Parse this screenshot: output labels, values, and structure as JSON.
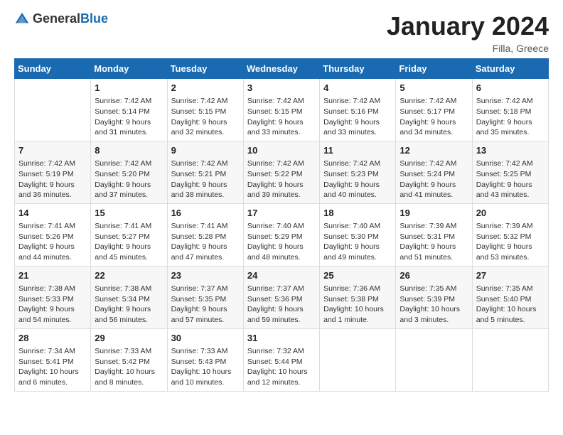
{
  "header": {
    "logo_general": "General",
    "logo_blue": "Blue",
    "title": "January 2024",
    "subtitle": "Filla, Greece"
  },
  "columns": [
    "Sunday",
    "Monday",
    "Tuesday",
    "Wednesday",
    "Thursday",
    "Friday",
    "Saturday"
  ],
  "weeks": [
    [
      {
        "day": "",
        "sunrise": "",
        "sunset": "",
        "daylight": ""
      },
      {
        "day": "1",
        "sunrise": "Sunrise: 7:42 AM",
        "sunset": "Sunset: 5:14 PM",
        "daylight": "Daylight: 9 hours and 31 minutes."
      },
      {
        "day": "2",
        "sunrise": "Sunrise: 7:42 AM",
        "sunset": "Sunset: 5:15 PM",
        "daylight": "Daylight: 9 hours and 32 minutes."
      },
      {
        "day": "3",
        "sunrise": "Sunrise: 7:42 AM",
        "sunset": "Sunset: 5:15 PM",
        "daylight": "Daylight: 9 hours and 33 minutes."
      },
      {
        "day": "4",
        "sunrise": "Sunrise: 7:42 AM",
        "sunset": "Sunset: 5:16 PM",
        "daylight": "Daylight: 9 hours and 33 minutes."
      },
      {
        "day": "5",
        "sunrise": "Sunrise: 7:42 AM",
        "sunset": "Sunset: 5:17 PM",
        "daylight": "Daylight: 9 hours and 34 minutes."
      },
      {
        "day": "6",
        "sunrise": "Sunrise: 7:42 AM",
        "sunset": "Sunset: 5:18 PM",
        "daylight": "Daylight: 9 hours and 35 minutes."
      }
    ],
    [
      {
        "day": "7",
        "sunrise": "Sunrise: 7:42 AM",
        "sunset": "Sunset: 5:19 PM",
        "daylight": "Daylight: 9 hours and 36 minutes."
      },
      {
        "day": "8",
        "sunrise": "Sunrise: 7:42 AM",
        "sunset": "Sunset: 5:20 PM",
        "daylight": "Daylight: 9 hours and 37 minutes."
      },
      {
        "day": "9",
        "sunrise": "Sunrise: 7:42 AM",
        "sunset": "Sunset: 5:21 PM",
        "daylight": "Daylight: 9 hours and 38 minutes."
      },
      {
        "day": "10",
        "sunrise": "Sunrise: 7:42 AM",
        "sunset": "Sunset: 5:22 PM",
        "daylight": "Daylight: 9 hours and 39 minutes."
      },
      {
        "day": "11",
        "sunrise": "Sunrise: 7:42 AM",
        "sunset": "Sunset: 5:23 PM",
        "daylight": "Daylight: 9 hours and 40 minutes."
      },
      {
        "day": "12",
        "sunrise": "Sunrise: 7:42 AM",
        "sunset": "Sunset: 5:24 PM",
        "daylight": "Daylight: 9 hours and 41 minutes."
      },
      {
        "day": "13",
        "sunrise": "Sunrise: 7:42 AM",
        "sunset": "Sunset: 5:25 PM",
        "daylight": "Daylight: 9 hours and 43 minutes."
      }
    ],
    [
      {
        "day": "14",
        "sunrise": "Sunrise: 7:41 AM",
        "sunset": "Sunset: 5:26 PM",
        "daylight": "Daylight: 9 hours and 44 minutes."
      },
      {
        "day": "15",
        "sunrise": "Sunrise: 7:41 AM",
        "sunset": "Sunset: 5:27 PM",
        "daylight": "Daylight: 9 hours and 45 minutes."
      },
      {
        "day": "16",
        "sunrise": "Sunrise: 7:41 AM",
        "sunset": "Sunset: 5:28 PM",
        "daylight": "Daylight: 9 hours and 47 minutes."
      },
      {
        "day": "17",
        "sunrise": "Sunrise: 7:40 AM",
        "sunset": "Sunset: 5:29 PM",
        "daylight": "Daylight: 9 hours and 48 minutes."
      },
      {
        "day": "18",
        "sunrise": "Sunrise: 7:40 AM",
        "sunset": "Sunset: 5:30 PM",
        "daylight": "Daylight: 9 hours and 49 minutes."
      },
      {
        "day": "19",
        "sunrise": "Sunrise: 7:39 AM",
        "sunset": "Sunset: 5:31 PM",
        "daylight": "Daylight: 9 hours and 51 minutes."
      },
      {
        "day": "20",
        "sunrise": "Sunrise: 7:39 AM",
        "sunset": "Sunset: 5:32 PM",
        "daylight": "Daylight: 9 hours and 53 minutes."
      }
    ],
    [
      {
        "day": "21",
        "sunrise": "Sunrise: 7:38 AM",
        "sunset": "Sunset: 5:33 PM",
        "daylight": "Daylight: 9 hours and 54 minutes."
      },
      {
        "day": "22",
        "sunrise": "Sunrise: 7:38 AM",
        "sunset": "Sunset: 5:34 PM",
        "daylight": "Daylight: 9 hours and 56 minutes."
      },
      {
        "day": "23",
        "sunrise": "Sunrise: 7:37 AM",
        "sunset": "Sunset: 5:35 PM",
        "daylight": "Daylight: 9 hours and 57 minutes."
      },
      {
        "day": "24",
        "sunrise": "Sunrise: 7:37 AM",
        "sunset": "Sunset: 5:36 PM",
        "daylight": "Daylight: 9 hours and 59 minutes."
      },
      {
        "day": "25",
        "sunrise": "Sunrise: 7:36 AM",
        "sunset": "Sunset: 5:38 PM",
        "daylight": "Daylight: 10 hours and 1 minute."
      },
      {
        "day": "26",
        "sunrise": "Sunrise: 7:35 AM",
        "sunset": "Sunset: 5:39 PM",
        "daylight": "Daylight: 10 hours and 3 minutes."
      },
      {
        "day": "27",
        "sunrise": "Sunrise: 7:35 AM",
        "sunset": "Sunset: 5:40 PM",
        "daylight": "Daylight: 10 hours and 5 minutes."
      }
    ],
    [
      {
        "day": "28",
        "sunrise": "Sunrise: 7:34 AM",
        "sunset": "Sunset: 5:41 PM",
        "daylight": "Daylight: 10 hours and 6 minutes."
      },
      {
        "day": "29",
        "sunrise": "Sunrise: 7:33 AM",
        "sunset": "Sunset: 5:42 PM",
        "daylight": "Daylight: 10 hours and 8 minutes."
      },
      {
        "day": "30",
        "sunrise": "Sunrise: 7:33 AM",
        "sunset": "Sunset: 5:43 PM",
        "daylight": "Daylight: 10 hours and 10 minutes."
      },
      {
        "day": "31",
        "sunrise": "Sunrise: 7:32 AM",
        "sunset": "Sunset: 5:44 PM",
        "daylight": "Daylight: 10 hours and 12 minutes."
      },
      {
        "day": "",
        "sunrise": "",
        "sunset": "",
        "daylight": ""
      },
      {
        "day": "",
        "sunrise": "",
        "sunset": "",
        "daylight": ""
      },
      {
        "day": "",
        "sunrise": "",
        "sunset": "",
        "daylight": ""
      }
    ]
  ]
}
